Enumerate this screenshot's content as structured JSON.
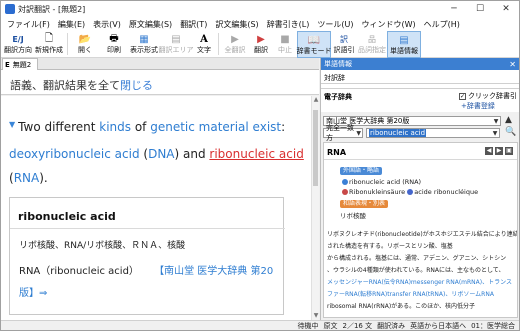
{
  "window": {
    "title": "対訳翻訳 - [無題2]",
    "minimize": "─",
    "maximize": "☐",
    "close": "✕"
  },
  "menu": [
    "ファイル(F)",
    "編集(E)",
    "表示(V)",
    "原文編集(S)",
    "翻訳(T)",
    "訳文編集(S)",
    "辞書引き(L)",
    "ツール(U)",
    "ウィンドウ(W)",
    "ヘルプ(H)"
  ],
  "toolbar": {
    "items": [
      {
        "label": "翻訳方向",
        "icon": "E/J",
        "disabled": false
      },
      {
        "label": "新規作成",
        "icon": "🗋",
        "disabled": false
      },
      {
        "label": "開く",
        "icon": "📂",
        "disabled": false
      },
      {
        "label": "印刷",
        "icon": "🖶",
        "disabled": false
      },
      {
        "label": "表示形式",
        "icon": "▦",
        "disabled": false
      },
      {
        "label": "翻訳エリア",
        "icon": "▤",
        "disabled": true
      },
      {
        "label": "文字",
        "icon": "A",
        "disabled": false
      },
      {
        "label": "全翻訳",
        "icon": "▶",
        "disabled": true
      },
      {
        "label": "翻訳",
        "icon": "▶",
        "disabled": false
      },
      {
        "label": "中止",
        "icon": "■",
        "disabled": true
      },
      {
        "label": "辞書モード",
        "icon": "📖",
        "disabled": false,
        "pressed": true
      },
      {
        "label": "訳語引",
        "icon": "訳",
        "disabled": false
      },
      {
        "label": "品詞指定",
        "icon": "品",
        "disabled": true
      },
      {
        "label": "単語情報",
        "icon": "▤",
        "disabled": false,
        "pressed": true
      }
    ]
  },
  "tab": {
    "letter": "E",
    "name": "無題2"
  },
  "source": {
    "text": "語義、翻訳結果を全て",
    "link": "閉じる"
  },
  "translation": {
    "line1_pre": "Two different ",
    "kinds": "kinds",
    "of": " of ",
    "genetic": "genetic material exist",
    "colon": ":",
    "deoxy": "deoxyribonucleic acid",
    "dna_open": " (",
    "dna": "DNA",
    "dna_close": ") and ",
    "ribo": "ribonucleic acid",
    "rna_open": "(",
    "rna": "RNA",
    "rna_close": ")."
  },
  "popup": {
    "headword": "ribonucleic acid",
    "line1": "リボ核酸、RNA/リボ核酸、ＲＮＡ、核酸",
    "line2": "RNA（ribonucleic acid）",
    "source_ref": "【南山堂 医学大辞典 第20",
    "source_ref2": "版】⇒"
  },
  "right_panel": {
    "title": "単語情報",
    "close": "✕",
    "word": "対訳辞",
    "dict_label": "電子辞典",
    "click_lookup": "クリック辞書引",
    "dict_register": "辞書登録",
    "dict_name": "南山堂 医学大辞典 第20版",
    "mode": "完全一致方",
    "query": "ribonucleic acid",
    "entry": {
      "headword": "RNA",
      "badge1": "外国語・略語",
      "e1": "ribonucleic acid (RNA)",
      "e2": "Ribonukleinsäure",
      "e2b": "acide ribonucléique",
      "badge2": "和語表現・別表",
      "e3": "リボ核酸",
      "body": [
        "リボヌクレオチド(ribonucleotide)がホスホジエステル結合により連結",
        "された構造を有する。リボースとリン酸、塩基",
        "から構成される。塩基には、通常、アデニン、グアニン、シトシン",
        "、ウラシルの4種類が使われている。RNAには、主なものとして、",
        "メッセンジャーRNA(伝令RNA)messenger RNA(mRNA)、トランス",
        "ファーRNA(転移RNA)transfer RNA(tRNA)、リボソームRNA",
        "ribosomal RNA(rRNA)がある。このほか、核内低分子"
      ]
    }
  },
  "status": {
    "state": "待機中",
    "source": "原文",
    "pos": "2／16 文",
    "trans": "翻訳済み",
    "dir": "英語から日本語へ",
    "dict": "01：医学総合"
  },
  "colors": {
    "accent": "#3c7fd1",
    "link": "#2e7dd1",
    "error_underline": "#d93030"
  }
}
